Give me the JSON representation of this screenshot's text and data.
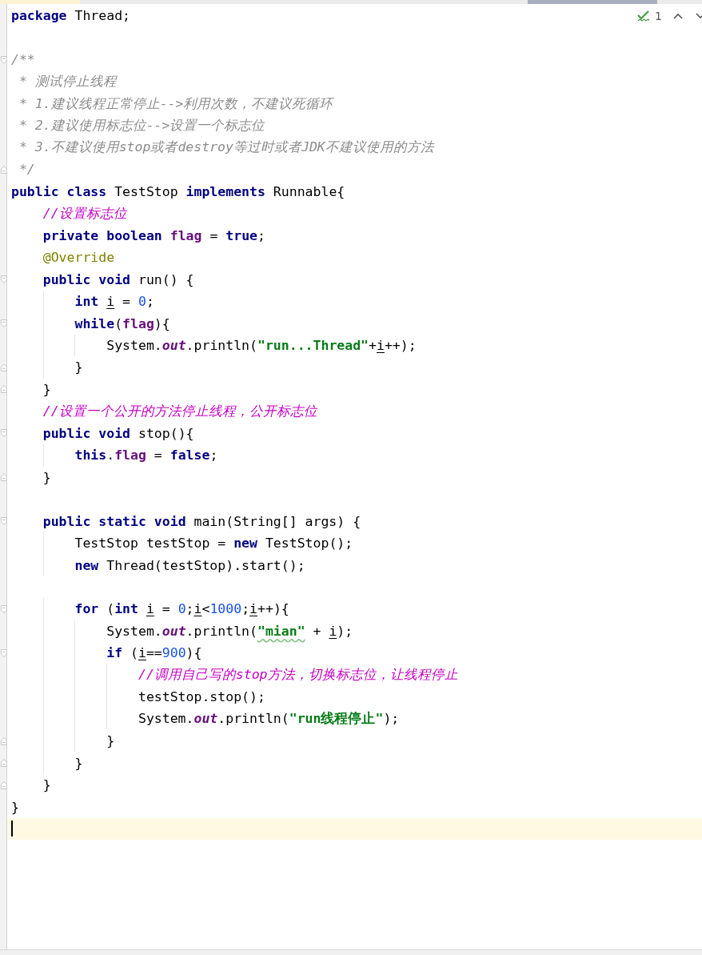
{
  "editor": {
    "inspection": {
      "count": "1"
    },
    "lines": [
      {
        "current": false,
        "kind": "code",
        "tokens": [
          {
            "kind": "kw",
            "text": "package"
          },
          {
            "kind": "plain",
            "text": " Thread;"
          }
        ]
      },
      {
        "current": false,
        "kind": "code"
      },
      {
        "current": false,
        "kind": "fold-start",
        "tokens": [
          {
            "kind": "doc",
            "text": "/**"
          }
        ]
      },
      {
        "current": false,
        "kind": "code",
        "tokens": [
          {
            "kind": "doc",
            "text": " * 测试停止线程"
          }
        ]
      },
      {
        "current": false,
        "kind": "code",
        "tokens": [
          {
            "kind": "doc",
            "text": " * 1.建议线程正常停止-->利用次数，不建议死循环"
          }
        ]
      },
      {
        "current": false,
        "kind": "code",
        "tokens": [
          {
            "kind": "doc",
            "text": " * 2.建议使用标志位-->设置一个标志位"
          }
        ]
      },
      {
        "current": false,
        "kind": "code",
        "tokens": [
          {
            "kind": "doc",
            "text": " * 3.不建议使用stop或者destroy等过时或者JDK不建议使用的方法"
          }
        ]
      },
      {
        "current": false,
        "kind": "fold-end",
        "tokens": [
          {
            "kind": "doc",
            "text": " */"
          }
        ]
      },
      {
        "current": false,
        "kind": "code",
        "tokens": [
          {
            "kind": "kw",
            "text": "public class"
          },
          {
            "kind": "plain",
            "text": " TestStop "
          },
          {
            "kind": "kw",
            "text": "implements"
          },
          {
            "kind": "plain",
            "text": " Runnable{"
          }
        ]
      },
      {
        "current": false,
        "kind": "code",
        "tokens": [
          {
            "kind": "comment",
            "text": "    //设置标志位"
          }
        ]
      },
      {
        "current": false,
        "kind": "code",
        "tokens": [
          {
            "kind": "kw",
            "text": "    private boolean "
          },
          {
            "kind": "field",
            "text": "flag"
          },
          {
            "kind": "plain",
            "text": " = "
          },
          {
            "kind": "kw",
            "text": "true"
          },
          {
            "kind": "plain",
            "text": ";"
          }
        ]
      },
      {
        "current": false,
        "kind": "code",
        "tokens": [
          {
            "kind": "anno",
            "text": "    @Override"
          }
        ]
      },
      {
        "current": false,
        "kind": "fold-start",
        "tokens": [
          {
            "kind": "kw",
            "text": "    public void"
          },
          {
            "kind": "plain",
            "text": " run() {"
          }
        ]
      },
      {
        "current": false,
        "kind": "code",
        "tokens": [
          {
            "kind": "kw",
            "text": "        int "
          },
          {
            "kind": "var",
            "text": "i"
          },
          {
            "kind": "plain",
            "text": " = "
          },
          {
            "kind": "num",
            "text": "0"
          },
          {
            "kind": "plain",
            "text": ";"
          }
        ]
      },
      {
        "current": false,
        "kind": "fold-start",
        "tokens": [
          {
            "kind": "kw",
            "text": "        while"
          },
          {
            "kind": "plain",
            "text": "("
          },
          {
            "kind": "field",
            "text": "flag"
          },
          {
            "kind": "plain",
            "text": "){"
          }
        ]
      },
      {
        "current": false,
        "kind": "code",
        "tokens": [
          {
            "kind": "plain",
            "text": "            System."
          },
          {
            "kind": "static",
            "text": "out"
          },
          {
            "kind": "plain",
            "text": ".println("
          },
          {
            "kind": "str",
            "text": "\"run...Thread\""
          },
          {
            "kind": "plain",
            "text": "+"
          },
          {
            "kind": "var",
            "text": "i"
          },
          {
            "kind": "plain",
            "text": "++);"
          }
        ]
      },
      {
        "current": false,
        "kind": "fold-end",
        "tokens": [
          {
            "kind": "plain",
            "text": "        }"
          }
        ]
      },
      {
        "current": false,
        "kind": "fold-end",
        "tokens": [
          {
            "kind": "plain",
            "text": "    }"
          }
        ]
      },
      {
        "current": false,
        "kind": "code",
        "tokens": [
          {
            "kind": "comment",
            "text": "    //设置一个公开的方法停止线程，公开标志位"
          }
        ]
      },
      {
        "current": false,
        "kind": "fold-start",
        "tokens": [
          {
            "kind": "kw",
            "text": "    public void"
          },
          {
            "kind": "plain",
            "text": " stop(){"
          }
        ]
      },
      {
        "current": false,
        "kind": "code",
        "tokens": [
          {
            "kind": "kw",
            "text": "        this"
          },
          {
            "kind": "plain",
            "text": "."
          },
          {
            "kind": "field",
            "text": "flag"
          },
          {
            "kind": "plain",
            "text": " = "
          },
          {
            "kind": "kw",
            "text": "false"
          },
          {
            "kind": "plain",
            "text": ";"
          }
        ]
      },
      {
        "current": false,
        "kind": "fold-end",
        "tokens": [
          {
            "kind": "plain",
            "text": "    }"
          }
        ]
      },
      {
        "current": false,
        "kind": "code"
      },
      {
        "current": false,
        "kind": "fold-start",
        "tokens": [
          {
            "kind": "kw",
            "text": "    public static void"
          },
          {
            "kind": "plain",
            "text": " main(String[] args) {"
          }
        ]
      },
      {
        "current": false,
        "kind": "code",
        "tokens": [
          {
            "kind": "plain",
            "text": "        TestStop testStop = "
          },
          {
            "kind": "kw",
            "text": "new"
          },
          {
            "kind": "plain",
            "text": " TestStop();"
          }
        ]
      },
      {
        "current": false,
        "kind": "code",
        "tokens": [
          {
            "kind": "kw",
            "text": "        new"
          },
          {
            "kind": "plain",
            "text": " Thread(testStop).start();"
          }
        ]
      },
      {
        "current": false,
        "kind": "code"
      },
      {
        "current": false,
        "kind": "fold-start",
        "tokens": [
          {
            "kind": "kw",
            "text": "        for"
          },
          {
            "kind": "plain",
            "text": " ("
          },
          {
            "kind": "kw",
            "text": "int "
          },
          {
            "kind": "var",
            "text": "i"
          },
          {
            "kind": "plain",
            "text": " = "
          },
          {
            "kind": "num",
            "text": "0"
          },
          {
            "kind": "plain",
            "text": ";"
          },
          {
            "kind": "var",
            "text": "i"
          },
          {
            "kind": "plain",
            "text": "<"
          },
          {
            "kind": "num",
            "text": "1000"
          },
          {
            "kind": "plain",
            "text": ";"
          },
          {
            "kind": "var",
            "text": "i"
          },
          {
            "kind": "plain",
            "text": "++){"
          }
        ]
      },
      {
        "current": false,
        "kind": "code",
        "tokens": [
          {
            "kind": "plain",
            "text": "            System."
          },
          {
            "kind": "static",
            "text": "out"
          },
          {
            "kind": "plain",
            "text": ".println("
          },
          {
            "kind": "str-warn",
            "text": "\"mian\""
          },
          {
            "kind": "plain",
            "text": " + "
          },
          {
            "kind": "var",
            "text": "i"
          },
          {
            "kind": "plain",
            "text": ");"
          }
        ]
      },
      {
        "current": false,
        "kind": "fold-start",
        "tokens": [
          {
            "kind": "kw",
            "text": "            if"
          },
          {
            "kind": "plain",
            "text": " ("
          },
          {
            "kind": "var",
            "text": "i"
          },
          {
            "kind": "plain",
            "text": "=="
          },
          {
            "kind": "num",
            "text": "900"
          },
          {
            "kind": "plain",
            "text": "){"
          }
        ]
      },
      {
        "current": false,
        "kind": "code",
        "tokens": [
          {
            "kind": "comment",
            "text": "                //调用自己写的stop方法，切换标志位，让线程停止"
          }
        ]
      },
      {
        "current": false,
        "kind": "code",
        "tokens": [
          {
            "kind": "plain",
            "text": "                testStop.stop();"
          }
        ]
      },
      {
        "current": false,
        "kind": "code",
        "tokens": [
          {
            "kind": "plain",
            "text": "                System."
          },
          {
            "kind": "static",
            "text": "out"
          },
          {
            "kind": "plain",
            "text": ".println("
          },
          {
            "kind": "str",
            "text": "\"run线程停止\""
          },
          {
            "kind": "plain",
            "text": ");"
          }
        ]
      },
      {
        "current": false,
        "kind": "fold-end",
        "tokens": [
          {
            "kind": "plain",
            "text": "            }"
          }
        ]
      },
      {
        "current": false,
        "kind": "fold-end",
        "tokens": [
          {
            "kind": "plain",
            "text": "        }"
          }
        ]
      },
      {
        "current": false,
        "kind": "fold-end",
        "tokens": [
          {
            "kind": "plain",
            "text": "    }"
          }
        ]
      },
      {
        "current": false,
        "kind": "code",
        "tokens": [
          {
            "kind": "plain",
            "text": "}"
          }
        ]
      },
      {
        "current": true,
        "kind": "code"
      }
    ]
  }
}
